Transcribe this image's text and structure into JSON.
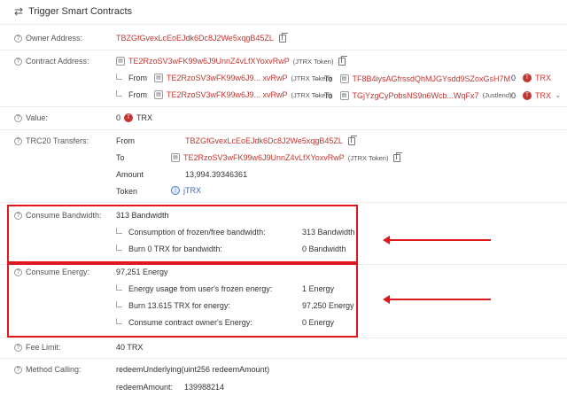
{
  "header": {
    "title": "Trigger Smart Contracts",
    "icon": "swap-arrows-icon"
  },
  "owner": {
    "label": "Owner Address:",
    "address": "TBZGfGvexLcEoEJdk6Dc8J2We5xqgB45ZL"
  },
  "contract": {
    "label": "Contract Address:",
    "address": "TE2RzoSV3wFK99w6J9UnnZ4vLfXYoxvRwP",
    "tag": "(JTRX Token)",
    "transfers": [
      {
        "from_label": "From",
        "from": "TE2RzoSV3wFK99w6J9... xvRwP",
        "from_tag": "(JTRX Token)",
        "to_label": "To",
        "to": "TF8B4iysAGfrssdQhMJGYsdd9SZoxGsH7M",
        "to_tag": "",
        "amount": "0",
        "unit": "TRX"
      },
      {
        "from_label": "From",
        "from": "TE2RzoSV3wFK99w6J9... xvRwP",
        "from_tag": "(JTRX Token)",
        "to_label": "To",
        "to": "TGjYzgCyPobsNS9n6Wcb...WqFx7",
        "to_tag": "(Justlend)",
        "amount": "0",
        "unit": "TRX"
      }
    ]
  },
  "value": {
    "label": "Value:",
    "amount": "0",
    "unit": "TRX"
  },
  "trc20": {
    "label": "TRC20 Transfers:",
    "from_label": "From",
    "from": "TBZGfGvexLcEoEJdk6Dc8J2We5xqgB45ZL",
    "to_label": "To",
    "to": "TE2RzoSV3wFK99w6J9UnnZ4vLfXYoxvRwP",
    "to_tag": "(JTRX Token)",
    "amount_label": "Amount",
    "amount": "13,994.39346361",
    "token_label": "Token",
    "token": "jTRX"
  },
  "bandwidth": {
    "label": "Consume Bandwidth:",
    "total": "313 Bandwidth",
    "rows": [
      {
        "label": "Consumption of frozen/free bandwidth:",
        "value": "313 Bandwidth"
      },
      {
        "label": "Burn 0 TRX for bandwidth:",
        "value": "0 Bandwidth"
      }
    ]
  },
  "energy": {
    "label": "Consume Energy:",
    "total": "97,251 Energy",
    "rows": [
      {
        "label": "Energy usage from user's frozen energy:",
        "value": "1 Energy"
      },
      {
        "label": "Burn 13.615 TRX for energy:",
        "value": "97,250 Energy"
      },
      {
        "label": "Consume contract owner's Energy:",
        "value": "0 Energy"
      }
    ]
  },
  "fee_limit": {
    "label": "Fee Limit:",
    "value": "40 TRX"
  },
  "method": {
    "label": "Method Calling:",
    "value": "redeemUnderlying(uint256 redeemAmount)",
    "param_label": "redeemAmount:",
    "param_value": "139988214"
  },
  "colors": {
    "address": "#c23631",
    "annotation": "#e0171c",
    "token_link": "#3a63c9"
  }
}
